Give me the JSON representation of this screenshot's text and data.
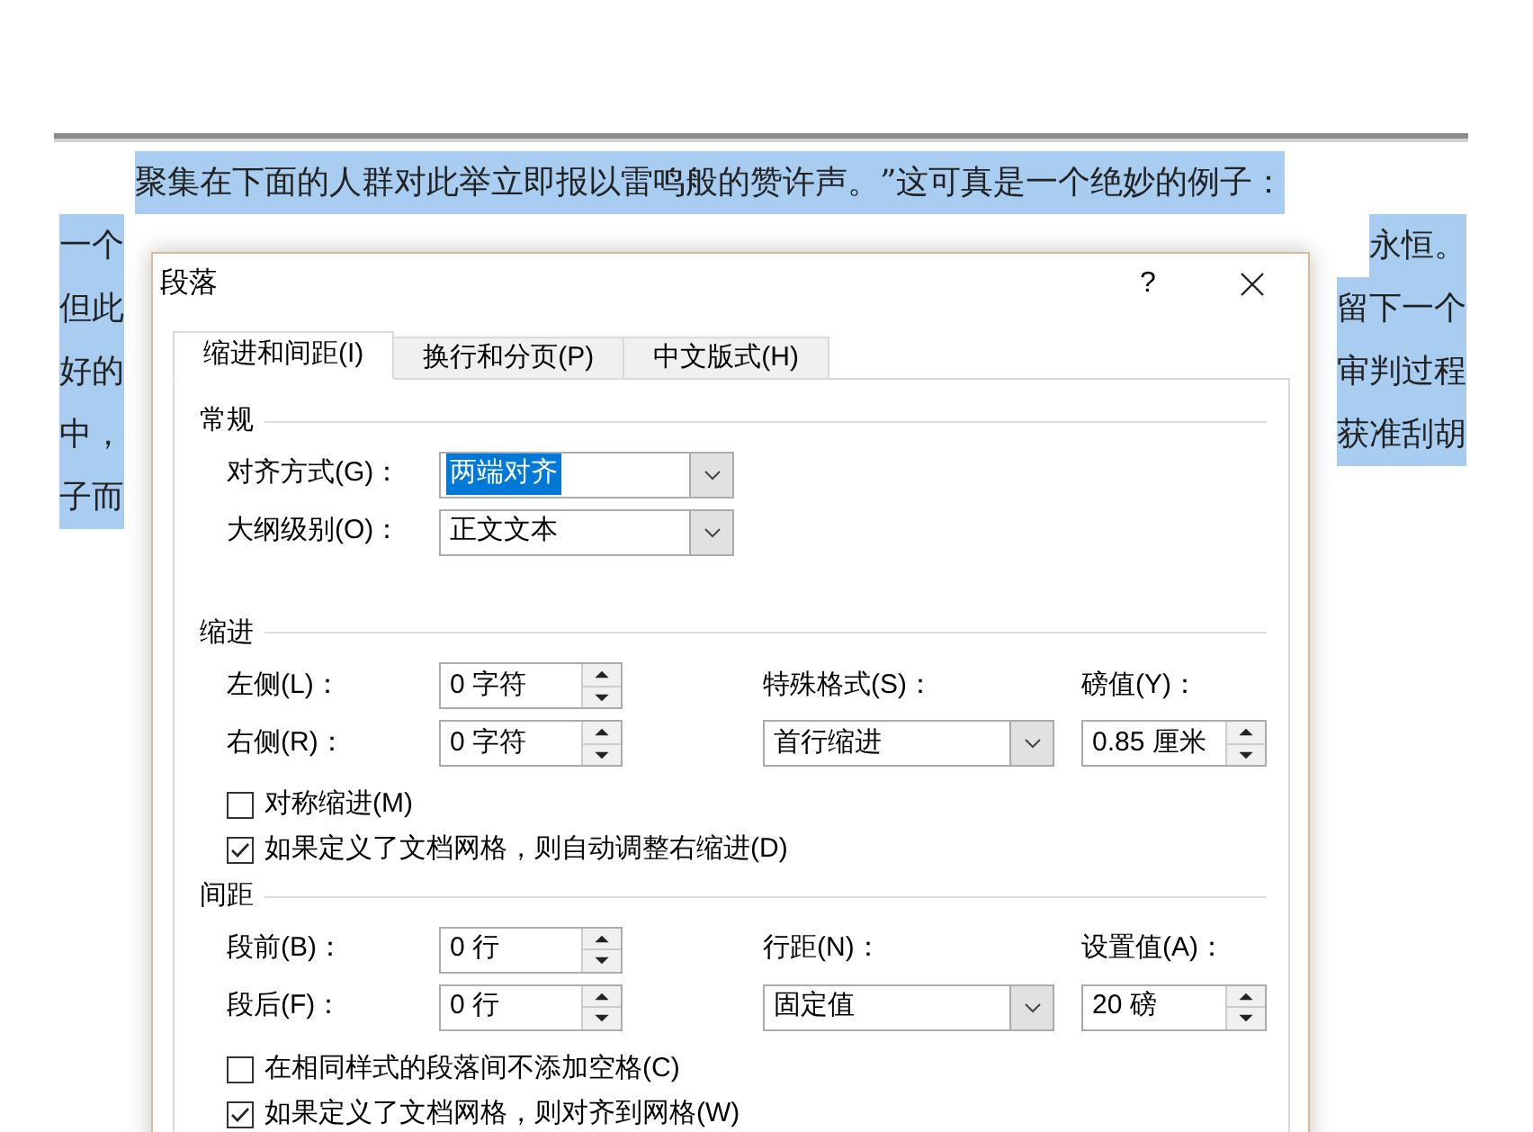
{
  "document": {
    "lines": [
      {
        "kind": "full",
        "text": "聚集在下面的人群对此举立即报以雷鸣般的赞许声。”这可真是一个绝妙的例子：",
        "selected": true
      },
      {
        "kind": "split",
        "left": "一个",
        "right": "永恒。",
        "selected": true
      },
      {
        "kind": "split",
        "left": "但此",
        "right": "留下一个",
        "selected": true
      },
      {
        "kind": "split",
        "left": "好的",
        "right": "审判过程",
        "selected": true
      },
      {
        "kind": "split",
        "left": "中，",
        "right": "获准刮胡",
        "selected": true
      },
      {
        "kind": "split",
        "left": "子而",
        "selected": true
      }
    ]
  },
  "dialog": {
    "title": "段落",
    "help": "?",
    "tabs": [
      {
        "label": "缩进和间距(I)",
        "selected": true
      },
      {
        "label": "换行和分页(P)",
        "selected": false
      },
      {
        "label": "中文版式(H)",
        "selected": false
      }
    ],
    "general": {
      "heading": "常规",
      "rows": [
        {
          "label": "对齐方式(G)：",
          "value": "两端对齐",
          "selected": true
        },
        {
          "label": "大纲级别(O)：",
          "value": "正文文本",
          "selected": false
        }
      ]
    },
    "indent": {
      "heading": "缩进",
      "rows": [
        {
          "label": "左侧(L)：",
          "value": "0 字符"
        },
        {
          "label": "右侧(R)：",
          "value": "0 字符"
        }
      ],
      "special_label": "特殊格式(S)：",
      "special_value": "首行缩进",
      "by_label": "磅值(Y)：",
      "by_value": "0.85 厘米",
      "checks": [
        {
          "label": "对称缩进(M)",
          "checked": false
        },
        {
          "label": "如果定义了文档网格，则自动调整右缩进(D)",
          "checked": true
        }
      ]
    },
    "spacing": {
      "heading": "间距",
      "rows": [
        {
          "label": "段前(B)：",
          "value": "0 行"
        },
        {
          "label": "段后(F)：",
          "value": "0 行"
        }
      ],
      "special_label": "行距(N)：",
      "special_value": "固定值",
      "by_label": "设置值(A)：",
      "by_value": "20 磅",
      "checks": [
        {
          "label": "在相同样式的段落间不添加空格(C)",
          "checked": false
        },
        {
          "label": "如果定义了文档网格，则对齐到网格(W)",
          "checked": true
        }
      ]
    }
  }
}
